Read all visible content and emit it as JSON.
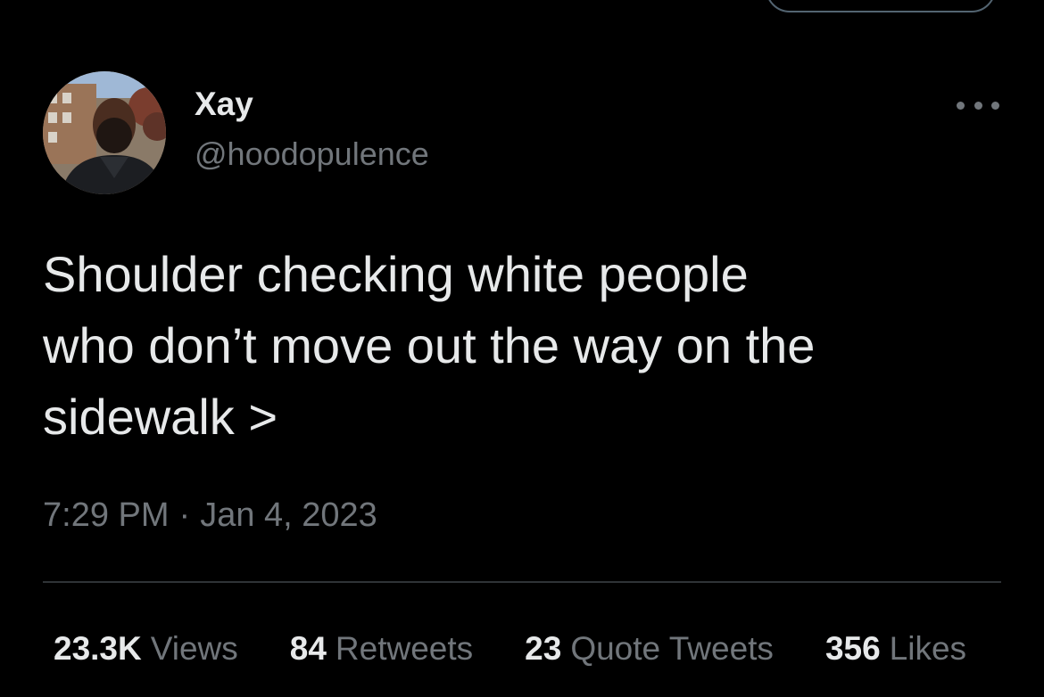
{
  "colors": {
    "background": "#000000",
    "primary_text": "#e7e9ea",
    "secondary_text": "#71767b",
    "divider": "#2f3336"
  },
  "author": {
    "display_name": "Xay",
    "handle": "@hoodopulence",
    "avatar_icon": "user-avatar-photo"
  },
  "tweet": {
    "text": "Shoulder checking white people\nwho don’t move out the way on the\nsidewalk >",
    "time": "7:29 PM",
    "separator": "·",
    "date": "Jan 4, 2023"
  },
  "stats": {
    "views": {
      "count": "23.3K",
      "label": "Views"
    },
    "retweets": {
      "count": "84",
      "label": "Retweets"
    },
    "quote_tweets": {
      "count": "23",
      "label": "Quote Tweets"
    },
    "likes": {
      "count": "356",
      "label": "Likes"
    }
  },
  "icons": {
    "more": "more-horizontal-icon"
  }
}
